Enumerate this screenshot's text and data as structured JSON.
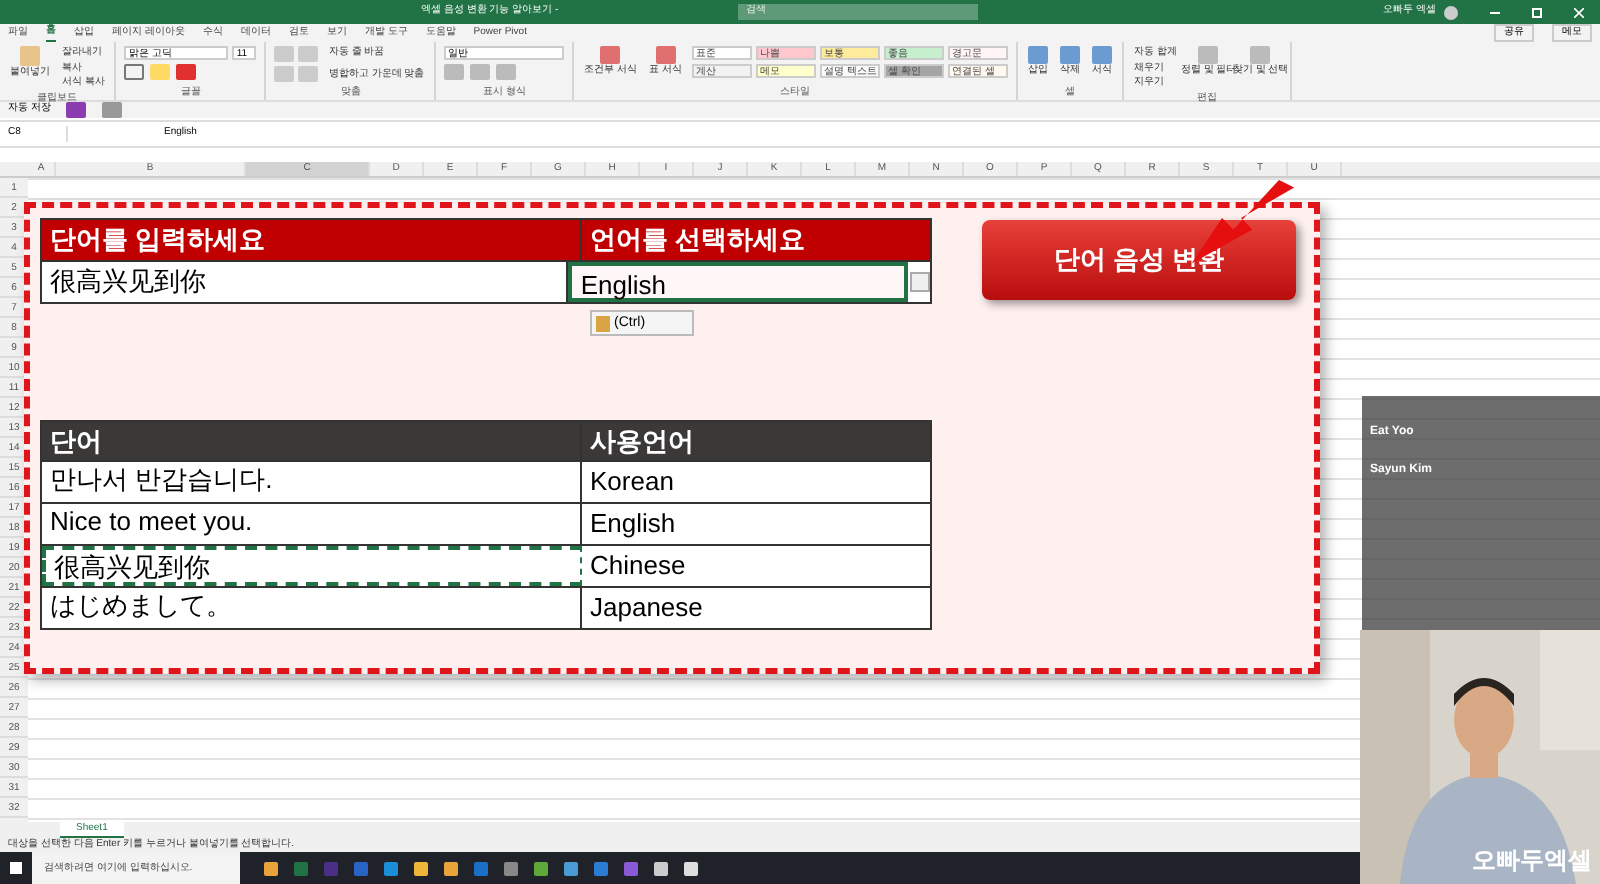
{
  "window": {
    "title": "엑셀 음성 변환 기능 알아보기 -",
    "search": {
      "placeholder": "검색"
    },
    "user": "오빠두 엑셀"
  },
  "ribbon": {
    "tabs": [
      {
        "label": "파일",
        "selected": false
      },
      {
        "label": "홈",
        "selected": true
      },
      {
        "label": "삽입",
        "selected": false
      },
      {
        "label": "페이지 레이아웃",
        "selected": false
      },
      {
        "label": "수식",
        "selected": false
      },
      {
        "label": "데이터",
        "selected": false
      },
      {
        "label": "검토",
        "selected": false
      },
      {
        "label": "보기",
        "selected": false
      },
      {
        "label": "개발 도구",
        "selected": false
      },
      {
        "label": "도움말",
        "selected": false
      },
      {
        "label": "Power Pivot",
        "selected": false
      }
    ],
    "share": "공유",
    "comments": "메모",
    "clipboard": {
      "paste": "붙여넣기",
      "items": [
        "잘라내기",
        "복사",
        "서식 복사"
      ],
      "label": "클립보드"
    },
    "font": {
      "name": "맑은 고딕",
      "size": "11",
      "label": "글꼴"
    },
    "align": {
      "items": [
        "자동 줄 바꿈",
        "병합하고 가운데 맞춤"
      ],
      "label": "맞춤"
    },
    "number": {
      "format": "일반",
      "label": "표시 형식"
    },
    "styles": {
      "buttons": [
        "조건부 서식",
        "표 서식"
      ],
      "cells": [
        {
          "label": "표준",
          "color": "#ffffff"
        },
        {
          "label": "나쁨",
          "color": "#ffc7ce"
        },
        {
          "label": "보통",
          "color": "#ffeb9c"
        },
        {
          "label": "좋음",
          "color": "#c6efce"
        },
        {
          "label": "경고문",
          "color": "#fff5f5"
        },
        {
          "label": "계산",
          "color": "#f2f2f2"
        },
        {
          "label": "메모",
          "color": "#ffffcc"
        },
        {
          "label": "설명 텍스트",
          "color": "#fafafa"
        },
        {
          "label": "셀 확인",
          "color": "#a5a5a5"
        },
        {
          "label": "연결된 셀",
          "color": "#fff8ee"
        }
      ],
      "label": "스타일"
    },
    "cells": {
      "buttons": [
        "삽입",
        "삭제",
        "서식"
      ],
      "label": "셀"
    },
    "editing": {
      "items": [
        "자동 합계",
        "채우기",
        "지우기"
      ],
      "buttons": [
        "정렬 및 필터",
        "찾기 및 선택"
      ],
      "label": "편집"
    }
  },
  "quick_access": {
    "autosave": "자동 저장"
  },
  "formula_bar": {
    "name_box": "C8",
    "value": "English"
  },
  "sheet": {
    "columns": [
      "A",
      "B",
      "C",
      "D",
      "E",
      "F",
      "G",
      "H",
      "I",
      "J",
      "K",
      "L",
      "M",
      "N",
      "O",
      "P",
      "Q",
      "R",
      "S",
      "T",
      "U"
    ],
    "rows": [
      "1",
      "2",
      "3",
      "4",
      "5",
      "6",
      "7",
      "8",
      "9",
      "10",
      "11",
      "12",
      "13",
      "14",
      "15",
      "16",
      "17",
      "18",
      "19",
      "20",
      "21",
      "22",
      "23",
      "24",
      "25",
      "26",
      "27",
      "28",
      "29",
      "30",
      "31",
      "32"
    ],
    "input_table": {
      "headers": [
        "단어를 입력하세요",
        "언어를 선택하세요"
      ],
      "word": "很高兴见到你",
      "language": "English"
    },
    "paste_options": "(Ctrl)",
    "button": "단어 음성 변환",
    "list_table": {
      "headers": [
        "단어",
        "사용언어"
      ],
      "rows": [
        {
          "word": "만나서 반갑습니다.",
          "language": "Korean",
          "copied": false
        },
        {
          "word": "Nice to meet you.",
          "language": "English",
          "copied": false
        },
        {
          "word": "很高兴见到你",
          "language": "Chinese",
          "copied": true
        },
        {
          "word": "はじめまして。",
          "language": "Japanese",
          "copied": false
        }
      ]
    }
  },
  "sheet_tabs": [
    {
      "label": "Sheet1",
      "selected": true
    }
  ],
  "status_bar": "대상을 선택한 다음 Enter 키를 누르거나 붙여넣기를 선택합니다.",
  "taskbar": {
    "search": {
      "placeholder": "검색하려면 여기에 입력하십시오."
    }
  },
  "chat": {
    "messages": [
      {
        "author": "Eat Yoo"
      },
      {
        "author": "Sayun Kim"
      }
    ]
  },
  "overlay": {
    "logo": "오빠두엑셀"
  }
}
